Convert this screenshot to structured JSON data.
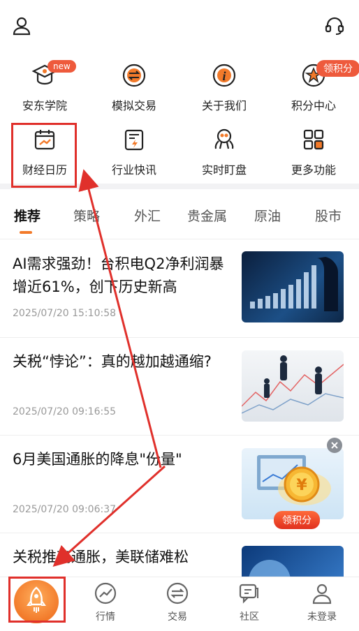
{
  "grid_items": [
    {
      "label": "安东学院",
      "icon": "graduation-cap-icon"
    },
    {
      "label": "模拟交易",
      "icon": "exchange-circle-icon"
    },
    {
      "label": "关于我们",
      "icon": "info-circle-icon"
    },
    {
      "label": "积分中心",
      "icon": "star-badge-icon"
    },
    {
      "label": "财经日历",
      "icon": "calendar-icon"
    },
    {
      "label": "行业快讯",
      "icon": "news-flash-icon"
    },
    {
      "label": "实时盯盘",
      "icon": "watch-market-icon"
    },
    {
      "label": "更多功能",
      "icon": "grid-more-icon"
    }
  ],
  "badges": {
    "new": "new",
    "points": "领积分"
  },
  "tabs": [
    "推荐",
    "策略",
    "外汇",
    "贵金属",
    "原油",
    "股市"
  ],
  "news": [
    {
      "title": "AI需求强劲！台积电Q2净利润暴增近61%，创下历史新高",
      "time": "2025/07/20 15:10:58"
    },
    {
      "title": "关税“悖论”：真的越加越通缩?",
      "time": "2025/07/20 09:16:55"
    },
    {
      "title": "6月美国通胀的降息\"份量\"",
      "time": "2025/07/20 09:06:37"
    },
    {
      "title": "关税推高通胀，美联储难松",
      "time": ""
    }
  ],
  "floating_promo": {
    "label": "领积分"
  },
  "tabbar": [
    {
      "label": "",
      "icon": "rocket-icon"
    },
    {
      "label": "行情",
      "icon": "trend-icon"
    },
    {
      "label": "交易",
      "icon": "exchange-icon"
    },
    {
      "label": "社区",
      "icon": "chat-icon"
    },
    {
      "label": "未登录",
      "icon": "user-icon"
    }
  ],
  "colors": {
    "accent": "#f27a2a",
    "annotation": "#e0302b"
  }
}
